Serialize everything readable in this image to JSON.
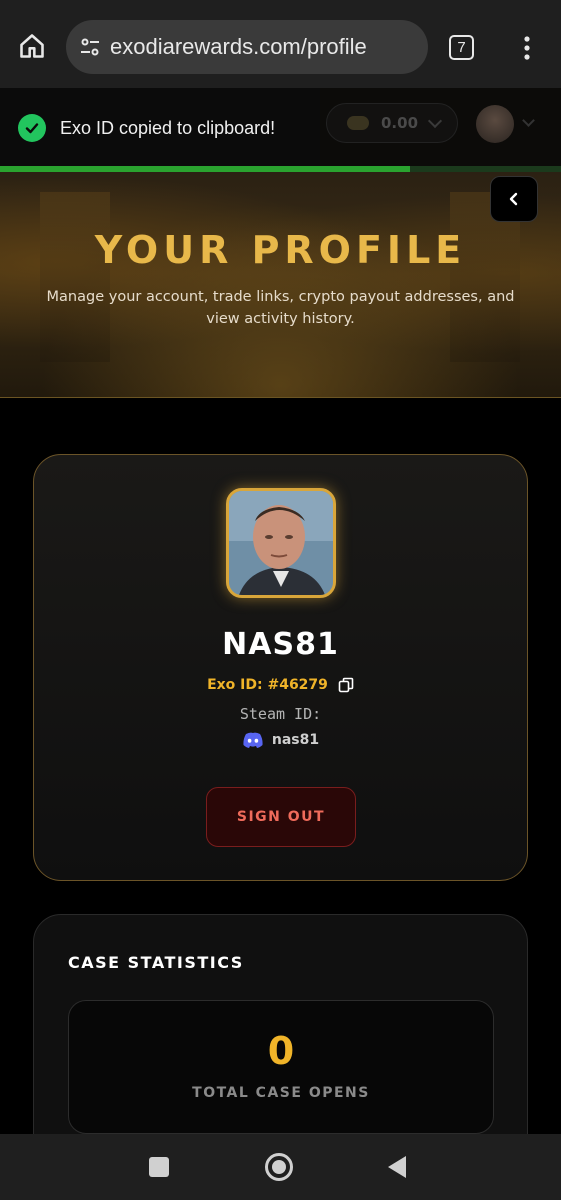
{
  "browser": {
    "url": "exodiarewards.com/profile",
    "tab_count": "7"
  },
  "header": {
    "balance": "0.00"
  },
  "toast": {
    "message": "Exo ID copied to clipboard!",
    "progress_fraction": 0.73
  },
  "hero": {
    "title": "YOUR PROFILE",
    "subtitle": "Manage your account, trade links, crypto payout addresses, and view activity history."
  },
  "profile": {
    "username": "NAS81",
    "exo_id": "Exo ID: #46279",
    "steam_id_label": "Steam ID:",
    "discord_name": "nas81",
    "sign_out_label": "SIGN OUT"
  },
  "stats": {
    "title": "CASE STATISTICS",
    "total_case_opens": "0",
    "total_case_opens_label": "TOTAL CASE OPENS"
  },
  "colors": {
    "accent_gold": "#e8b84a",
    "success_green": "#22c55e",
    "danger_red": "#ef6b5b"
  }
}
